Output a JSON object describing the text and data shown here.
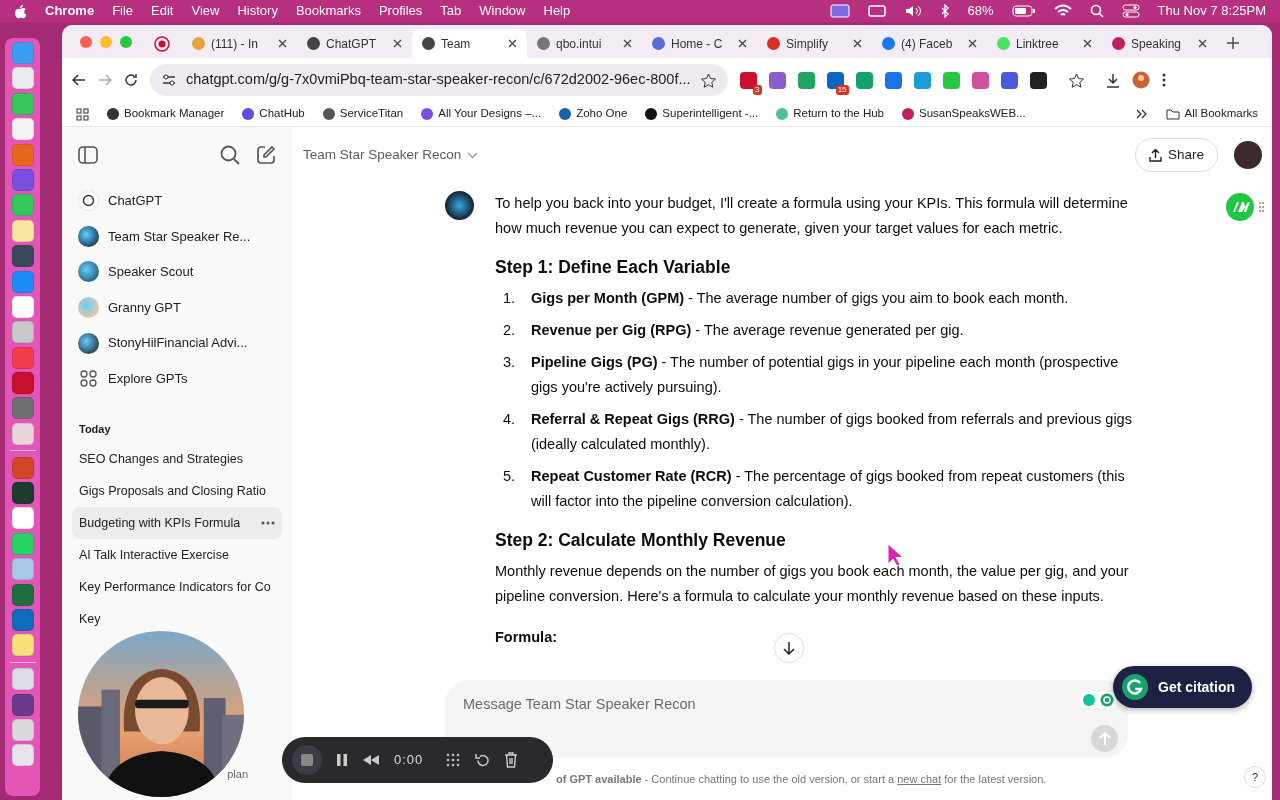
{
  "menubar": {
    "app": "Chrome",
    "menus": [
      "File",
      "Edit",
      "View",
      "History",
      "Bookmarks",
      "Profiles",
      "Tab",
      "Window",
      "Help"
    ],
    "battery": "68%",
    "datetime": "Thu Nov 7  8:25PM"
  },
  "dock": [
    [
      {
        "color": "#3d9bf0"
      },
      {
        "color": "#e9e9ef"
      },
      {
        "color": "#35c759"
      },
      {
        "color": "#f2f2f2"
      },
      {
        "color": "#e8651e"
      },
      {
        "color": "#7b4fe0"
      },
      {
        "color": "#34c759"
      },
      {
        "color": "#f6e7a0"
      },
      {
        "color": "#3a4a5c"
      },
      {
        "color": "#1b8cf5"
      },
      {
        "color": "#ffffff"
      },
      {
        "color": "#c9c9c9"
      },
      {
        "color": "#f23b4c"
      },
      {
        "color": "#c8102e"
      },
      {
        "color": "#6e6e73"
      },
      {
        "color": "#e8d6da"
      }
    ],
    [
      {
        "color": "#d24726"
      },
      {
        "color": "#1e3b2f"
      },
      {
        "color": "#ffffff"
      },
      {
        "color": "#25d366"
      },
      {
        "color": "#a8c8e8"
      },
      {
        "color": "#1d6f42"
      },
      {
        "color": "#0f6cbd"
      },
      {
        "color": "#f7e27a"
      }
    ],
    [
      {
        "color": "#dcdce4"
      },
      {
        "color": "#6b3a8a"
      },
      {
        "color": "#d8d8de"
      },
      {
        "color": "#e4e4ea"
      }
    ]
  ],
  "tabs": [
    {
      "label": "(111) - In",
      "selected": false
    },
    {
      "label": "ChatGPT",
      "selected": false
    },
    {
      "label": "Team",
      "selected": true
    },
    {
      "label": "qbo.intui",
      "selected": false
    },
    {
      "label": "Home - C",
      "selected": false
    },
    {
      "label": "Simplify",
      "selected": false
    },
    {
      "label": "(4) Faceb",
      "selected": false
    },
    {
      "label": "Linktree",
      "selected": false
    },
    {
      "label": "Speaking",
      "selected": false
    }
  ],
  "address": "chatgpt.com/g/g-7x0vmiPbq-team-star-speaker-recon/c/672d2002-96ec-800f...",
  "extensions": [
    {
      "color": "#c8102e",
      "badge": "3"
    },
    {
      "color": "#8a5cd0"
    },
    {
      "color": "#1fa463"
    },
    {
      "color": "#0a66c2",
      "badge": "15"
    },
    {
      "color": "#15a36b"
    },
    {
      "color": "#1a73e8"
    },
    {
      "color": "#1b9bd7"
    },
    {
      "color": "#26c742"
    },
    {
      "color": "#d04fa0"
    },
    {
      "color": "#4a5ad8"
    },
    {
      "color": "#222222"
    }
  ],
  "bookmarks": [
    "Bookmark Manager",
    "ChatHub",
    "ServiceTitan",
    "All Your Designs –...",
    "Zoho One",
    "Superintelligent -...",
    "Return to the Hub",
    "SusanSpeaksWEB..."
  ],
  "all_bookmarks": "All Bookmarks",
  "sidebar": {
    "gpts": [
      "ChatGPT",
      "Team Star Speaker Re...",
      "Speaker Scout",
      "Granny GPT",
      "StonyHilFinancial Advi...",
      "Explore GPTs"
    ],
    "section": "Today",
    "chats": [
      {
        "title": "SEO Changes and Strategies",
        "selected": false
      },
      {
        "title": "Gigs Proposals and Closing Ratio",
        "selected": false
      },
      {
        "title": "Budgeting with KPIs Formula",
        "selected": true
      },
      {
        "title": "AI Talk Interactive Exercise",
        "selected": false
      },
      {
        "title": "Key Performance Indicators for Co",
        "selected": false
      },
      {
        "title": "Key",
        "selected": false
      }
    ],
    "footer": "plan"
  },
  "header": {
    "title": "Team Star Speaker Recon",
    "share": "Share"
  },
  "message": {
    "intro": "To help you back into your budget, I'll create a formula using your KPIs. This formula will determine how much revenue you can expect to generate, given your target values for each metric.",
    "step1": "Step 1: Define Each Variable",
    "items": [
      {
        "num": "1.",
        "text": "**Gigs per Month (GPM)** - The average number of gigs you aim to book each month."
      },
      {
        "num": "2.",
        "text": "**Revenue per Gig (RPG)** - The average revenue generated per gig."
      },
      {
        "num": "3.",
        "text": "**Pipeline Gigs (PG)** - The number of potential gigs in your pipeline each month (prospective gigs you're actively pursuing)."
      },
      {
        "num": "4.",
        "text": "**Referral & Repeat Gigs (RRG)** - The number of gigs booked from referrals and previous gigs (ideally calculated monthly)."
      },
      {
        "num": "5.",
        "text": "**Repeat Customer Rate (RCR)** - The percentage of gigs booked from repeat customers (this will factor into the pipeline conversion calculation)."
      }
    ],
    "step2": "Step 2: Calculate Monthly Revenue",
    "para": "Monthly revenue depends on the number of gigs you book each month, the value per gig, and your pipeline conversion. Here's a formula to calculate your monthly revenue based on these inputs.",
    "formula": "Formula:"
  },
  "composer": {
    "placeholder": "Message Team Star Speaker Recon"
  },
  "footnote": {
    "lead": "of GPT available",
    "text": " - Continue chatting to use the old version, or start a ",
    "link": "new chat",
    "tail": " for the latest version."
  },
  "help": "?",
  "citation": "Get citation",
  "recorder": {
    "time": "0:00"
  }
}
